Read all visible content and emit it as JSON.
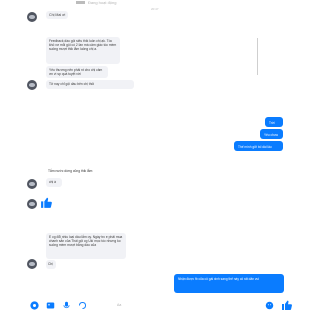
{
  "status_bar": {
    "text": "Đang hoạt động"
  },
  "chat": {
    "timestamp": "20:47",
    "other_name": "Chị Mai ơi",
    "messages": [
      {
        "from": "other",
        "text": "Feedback dầu gội siêu thik luôn chị ạk. Tóc khô xơ mỗi gội có 2 lần mà cảm giác tóc mềm suông mượt thik lắm luông chị a."
      },
      {
        "from": "other",
        "text": "Yêu thương nên phải nt cho chị cảm ơn vì sp quá tuyệt vời"
      },
      {
        "from": "other",
        "text": "Tử nay chỉ gội dầu bên chị thôi"
      },
      {
        "from": "me",
        "text": "Trời"
      },
      {
        "from": "me",
        "text": "Yêu chưa"
      },
      {
        "from": "me",
        "text": "Thế mình gửi bố dài lâu"
      },
      {
        "from": "other",
        "text": "Tắm nước dừng cũng thik lắm"
      },
      {
        "from": "other",
        "text": "chị à"
      },
      {
        "from": "other",
        "text": "like"
      },
      {
        "from": "other",
        "text": "E cg đổi nhiu loại dầu lắm oy. Ngày trc e phải mua chanh sẵn của Thái gội cg Ukí mọc tóc nhưng ko suông mềm mượt bằng dầu của"
      },
      {
        "from": "other",
        "text": "Chị"
      },
      {
        "from": "me",
        "text": "Nhận được fb của cô gái xinh sang thế này cô rất dân vui"
      }
    ]
  },
  "input_bar": {
    "placeholder": "Aa",
    "icons": [
      "camera-icon",
      "image-icon",
      "microphone-icon",
      "sticker-icon",
      "emoji-icon",
      "like-icon"
    ]
  },
  "colors": {
    "accent": "#0a7cff",
    "bubble_in": "#f1f2f6",
    "avatar": "#505560"
  }
}
